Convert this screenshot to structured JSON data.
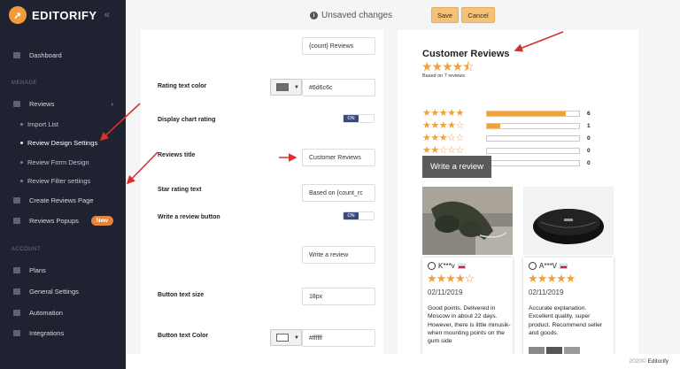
{
  "brand": {
    "name": "EDITORIFY",
    "collapse_icon": "chevron-double-left-icon",
    "logo_icon": "rocket-icon"
  },
  "sidebar": {
    "dashboard": "Dashboard",
    "manage_label": "MENAGE",
    "reviews": "Reviews",
    "import_list": "Import List",
    "review_design": "Review Design Settings",
    "review_form": "Review Form Design",
    "review_filter": "Review Filter settings",
    "create_reviews_page": "Create Reviews Page",
    "reviews_popups": "Reviews Popups",
    "new_badge": "New",
    "account_label": "ACCOUNT",
    "plans": "Plans",
    "general_settings": "General Settings",
    "automation": "Automation",
    "integrations": "Integrations"
  },
  "topbar": {
    "unsaved": "Unsaved changes",
    "save": "Save",
    "cancel": "Cancel"
  },
  "settings": {
    "count_reviews_value": "{count} Reviews",
    "rating_text_color_label": "Rating text color",
    "rating_text_color_value": "#6d6c6c",
    "display_chart_label": "Display chart rating",
    "toggle_on": "ON",
    "reviews_title_label": "Reviews title",
    "reviews_title_value": "Customer Reviews",
    "star_rating_text_label": "Star rating text",
    "star_rating_text_value": "Based on {count_rc",
    "write_review_btn_label": "Write a review button",
    "write_review_value": "Write a review",
    "button_text_size_label": "Button text size",
    "button_text_size_value": "18px",
    "button_text_color_label": "Button text Color",
    "button_text_color_value": "#ffffff"
  },
  "colors": {
    "rating_text": "#6d6c6c",
    "button_text": "#ffffff",
    "accent": "#f0a13a",
    "sidebar_bg": "#1f2230"
  },
  "preview": {
    "title": "Customer Reviews",
    "overall_rating": 4.5,
    "based_on": "Based on 7 reviews",
    "distribution": [
      {
        "stars": 5,
        "count": "6",
        "fraction": 0.857
      },
      {
        "stars": 4,
        "count": "1",
        "fraction": 0.143
      },
      {
        "stars": 3,
        "count": "0",
        "fraction": 0
      },
      {
        "stars": 2,
        "count": "0",
        "fraction": 0
      },
      {
        "stars": 1,
        "count": "0",
        "fraction": 0
      }
    ],
    "write_button": "Write a review",
    "reviews": [
      {
        "name": "K***v",
        "rating": 4,
        "date": "02/11/2019",
        "text": "Good points. Delivered in Moscow in about 22 days. However, there is little minusik-when mounting points on the gum side"
      },
      {
        "name": "A***V",
        "rating": 5,
        "date": "02/11/2019",
        "text": "Accurate explanation. Excellent quality, super product. Recommend seller and goods."
      }
    ]
  },
  "footer": {
    "year": "2020©",
    "brand": "Editorify"
  }
}
